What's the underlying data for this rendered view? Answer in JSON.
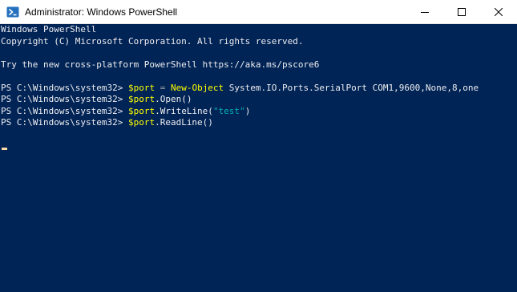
{
  "window": {
    "title": "Administrator: Windows PowerShell"
  },
  "colors": {
    "background": "#012456",
    "text": "#eeedf0",
    "variable": "#ffff00",
    "command": "#ffff00",
    "string": "#00b0b0",
    "operator": "#a0a0a0",
    "cursor": "#fedba9"
  },
  "icons": {
    "app": "powershell-icon",
    "minimize": "minimize-icon",
    "maximize": "maximize-icon",
    "close": "close-icon"
  },
  "console": {
    "header_line1": "Windows PowerShell",
    "header_line2": "Copyright (C) Microsoft Corporation. All rights reserved.",
    "info_line": "Try the new cross-platform PowerShell https://aka.ms/pscore6",
    "prompt": "PS C:\\Windows\\system32> ",
    "commands": [
      {
        "var": "$port",
        "op": " = ",
        "cmdlet": "New-Object",
        "rest": " System.IO.Ports.SerialPort COM1,9600,None,8,one"
      },
      {
        "var": "$port",
        "rest": ".Open()"
      },
      {
        "var": "$port",
        "rest_before": ".WriteLine(",
        "string": "\"test\"",
        "rest_after": ")"
      },
      {
        "var": "$port",
        "rest": ".ReadLine()"
      }
    ]
  }
}
